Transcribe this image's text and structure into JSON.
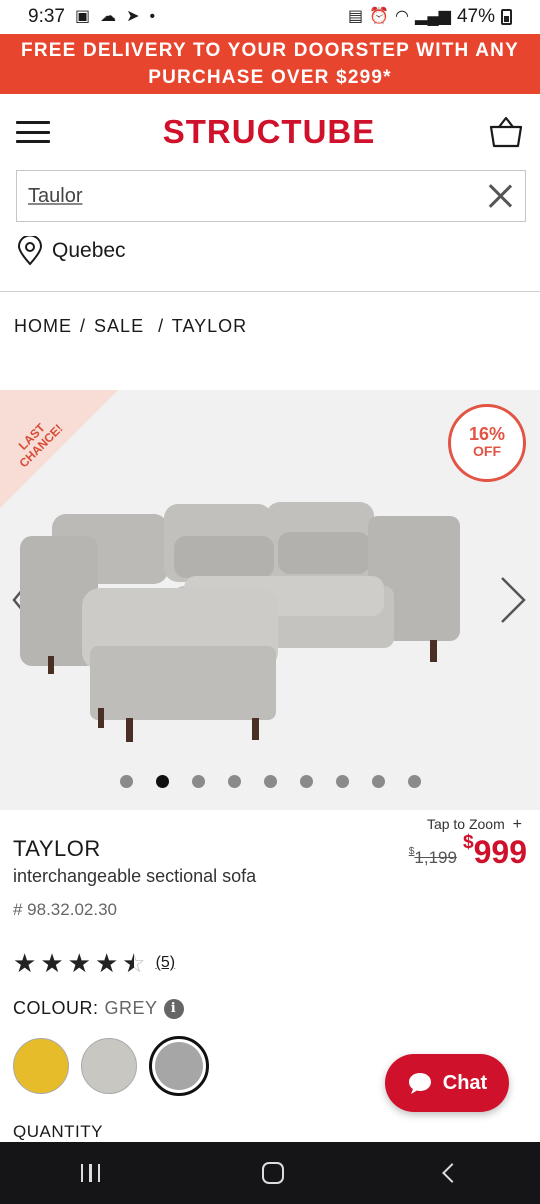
{
  "status_bar": {
    "time": "9:37",
    "battery": "47%"
  },
  "promo": {
    "text": "FREE DELIVERY TO YOUR DOORSTEP WITH ANY PURCHASE OVER $299*"
  },
  "header": {
    "logo": "STRUCTUBE"
  },
  "search": {
    "value": "Taulor"
  },
  "location": {
    "label": "Quebec"
  },
  "breadcrumb": {
    "items": [
      "HOME",
      "/",
      "SALE",
      "/",
      "TAYLOR"
    ]
  },
  "gallery": {
    "badge": "LAST CHANCE!",
    "badge_line1": "LAST",
    "badge_line2": "CHANCE!",
    "discount_pct": "16%",
    "discount_off": "OFF",
    "dot_count": 9,
    "active_dot": 2
  },
  "product": {
    "tap_zoom": "Tap to Zoom",
    "name": "TAYLOR",
    "subtitle": "interchangeable sectional sofa",
    "sku": "# 98.32.02.30",
    "old_price_symbol": "$",
    "old_price": "1,199",
    "new_price_symbol": "$",
    "new_price": "999",
    "rating": 4.5,
    "rating_count": "(5)",
    "colour_label": "COLOUR:",
    "colour_value": "GREY",
    "quantity_label": "QUANTITY"
  },
  "swatches": [
    {
      "name": "yellow",
      "color": "#e7bc2a"
    },
    {
      "name": "light-grey",
      "color": "#c9c7c2"
    },
    {
      "name": "grey",
      "color": "#a6a6a6",
      "selected": true
    }
  ],
  "chat": {
    "label": "Chat"
  },
  "colors": {
    "brand_red": "#d0112b",
    "promo": "#e8452f",
    "discount": "#e25443"
  }
}
